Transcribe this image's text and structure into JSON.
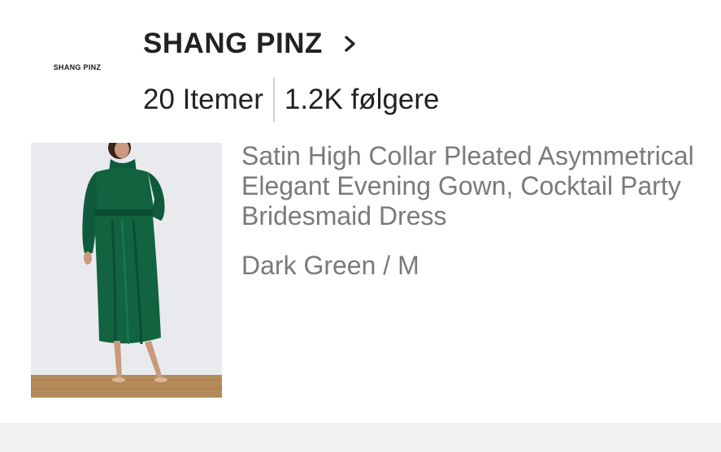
{
  "store": {
    "logo_text": "SHANG PINZ",
    "name": "SHANG PINZ",
    "items_count": "20 Itemer",
    "followers": "1.2K følgere"
  },
  "product": {
    "title": "Satin High Collar Pleated Asymmetrical Elegant Evening Gown, Cocktail Party Bridesmaid Dress",
    "variant": "Dark Green / M",
    "image_icon": "dress-photo",
    "dress_color": "#0f5a3c",
    "background_color": "#e9eaee"
  }
}
